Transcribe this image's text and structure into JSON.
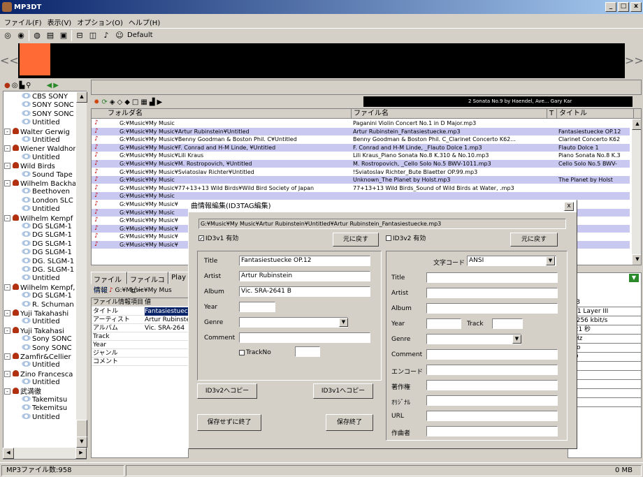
{
  "window": {
    "title": "MP3DT",
    "min": "_",
    "max": "□",
    "close": "x"
  },
  "menu": [
    "ファイル(F)",
    "表示(V)",
    "オプション(O)",
    "ヘルプ(H)"
  ],
  "toolbar": {
    "profile_label": "Default"
  },
  "player": {
    "prev": "<<",
    "next": ">>"
  },
  "tree": {
    "nodes": [
      {
        "label": "CBS SONY",
        "level": 2
      },
      {
        "label": "SONY SONC",
        "level": 2
      },
      {
        "label": "SONY SONC",
        "level": 2
      },
      {
        "label": "Untitled",
        "level": 2
      },
      {
        "label": "Walter Gerwig",
        "level": 1
      },
      {
        "label": "Untitled",
        "level": 2
      },
      {
        "label": "Wiener Waldhor",
        "level": 1
      },
      {
        "label": "Untitled",
        "level": 2
      },
      {
        "label": "Wild Birds",
        "level": 1
      },
      {
        "label": "Sound Tape",
        "level": 2
      },
      {
        "label": "Wilhelm Backha",
        "level": 1
      },
      {
        "label": "Beethoven",
        "level": 2
      },
      {
        "label": "London SLC",
        "level": 2
      },
      {
        "label": "Untitled",
        "level": 2
      },
      {
        "label": "Wilhelm Kempf",
        "level": 1
      },
      {
        "label": "DG SLGM-1",
        "level": 2
      },
      {
        "label": "DG SLGM-1",
        "level": 2
      },
      {
        "label": "DG SLGM-1",
        "level": 2
      },
      {
        "label": "DG SLGM-1",
        "level": 2
      },
      {
        "label": "DG. SLGM-1",
        "level": 2
      },
      {
        "label": "DG. SLGM-1",
        "level": 2
      },
      {
        "label": "Untitled",
        "level": 2
      },
      {
        "label": "Wilhelm Kempf,",
        "level": 1
      },
      {
        "label": "DG SLGM-1",
        "level": 2
      },
      {
        "label": "R. Schuman",
        "level": 2
      },
      {
        "label": "Yuji Takahashi",
        "level": 1
      },
      {
        "label": "Untitled",
        "level": 2
      },
      {
        "label": "Yuji Takahasi",
        "level": 1
      },
      {
        "label": "Sony SONC",
        "level": 2
      },
      {
        "label": "Sony SONC",
        "level": 2
      },
      {
        "label": "Zamfir&Cellier",
        "level": 1
      },
      {
        "label": "Untitled",
        "level": 2
      },
      {
        "label": "Zino Francesca",
        "level": 1
      },
      {
        "label": "Untitled",
        "level": 2
      },
      {
        "label": "武満徹",
        "level": 1
      },
      {
        "label": "Takemitsu",
        "level": 2
      },
      {
        "label": "Tekemitsu",
        "level": 2
      },
      {
        "label": "Untitled",
        "level": 2
      }
    ]
  },
  "nowplaying": "2   Sonata No.9 by Haendel, Ave...  Gary Kar",
  "filelist": {
    "headers": {
      "folder": "フォルダ名",
      "file": "ファイル名",
      "t": "T",
      "title": "タイトル"
    },
    "rows": [
      {
        "folder": "G:¥Music¥My Music",
        "file": "Paganini Violin Concert No.1 in D Major.mp3",
        "title": ""
      },
      {
        "folder": "G:¥Music¥My Music¥Artur Rubinstein¥Untitled",
        "file": "Artur Rubinstein_Fantasiestuecke.mp3",
        "title": "Fantasiestuecke OP.12"
      },
      {
        "folder": "G:¥Music¥My Music¥Benny Goodman & Boston Phil. C¥Untitled",
        "file": "Benny Goodman & Boston Phil. C_Clarinet Concerto K62...",
        "title": "Clarinet Concerto K62"
      },
      {
        "folder": "G:¥Music¥My Music¥F. Conrad and H-M Linde, ¥Untitled",
        "file": "F. Conrad and H-M Linde, _Flauto Dolce 1.mp3",
        "title": "Flauto Dolce 1"
      },
      {
        "folder": "G:¥Music¥My Music¥Lili Kraus",
        "file": "Lili Kraus_Piano Sonata No.8 K.310 & No.10.mp3",
        "title": "Piano Sonata No.8 K.3"
      },
      {
        "folder": "G:¥Music¥My Music¥M. Rostropovich, ¥Untitled",
        "file": "M. Rostropovich, _Cello Solo No.5 BWV-1011.mp3",
        "title": "Cello Solo No.5 BWV-"
      },
      {
        "folder": "G:¥Music¥My Music¥Sviatoslav Richter¥Untitled",
        "file": "!Sviatoslav Richter_Bute Blaetter OP.99.mp3",
        "title": ""
      },
      {
        "folder": "G:¥Music¥My Music",
        "file": "Unknown_The Planet by Holst.mp3",
        "title": "The Planet by Holst"
      },
      {
        "folder": "G:¥Music¥My Music¥77+13+13 Wild Birds¥Wild Bird Society of Japan",
        "file": "77+13+13 Wild Birds_Sound of Wild Birds at Water, .mp3",
        "title": ""
      },
      {
        "folder": "G:¥Music¥My Music",
        "file": "",
        "title": ""
      },
      {
        "folder": "G:¥Music¥My Music¥",
        "file": "",
        "title": ""
      },
      {
        "folder": "G:¥Music¥My Music",
        "file": "",
        "title": ""
      },
      {
        "folder": "G:¥Music¥My Music¥",
        "file": "",
        "title": ""
      },
      {
        "folder": "G:¥Music¥My Music¥",
        "file": "",
        "title": ""
      },
      {
        "folder": "G:¥Music¥My Music¥",
        "file": "",
        "title": ""
      },
      {
        "folder": "G:¥Music¥My Music¥",
        "file": "",
        "title": ""
      }
    ]
  },
  "lower": {
    "tabs": [
      "ファイル情報",
      "ファイルコピー",
      "Play"
    ],
    "path": "G:¥Music¥My Mus",
    "info_headers": {
      "item": "ファイル情報項目",
      "value": "値"
    },
    "info_rows": [
      {
        "item": "タイトル",
        "value": "Fantasiestuec"
      },
      {
        "item": "アーティスト",
        "value": "Artur Rubinste"
      },
      {
        "item": "アルバム",
        "value": "Vic. SRA-264"
      },
      {
        "item": "Track",
        "value": ""
      },
      {
        "item": "Year",
        "value": ""
      },
      {
        "item": "ジャンル",
        "value": ""
      },
      {
        "item": "コメント",
        "value": ""
      }
    ],
    "right_values": [
      "MB",
      "G 1 Layer III",
      "2 256 kbit/s",
      "021 秒",
      "KHz",
      "reo",
      "19",
      "",
      "e",
      "",
      "",
      ""
    ]
  },
  "status": {
    "count": "MP3ファイル数:958",
    "size": "0 MB"
  },
  "dialog": {
    "title": "曲情報編集(ID3TAG編集)",
    "close": "x",
    "path": "G:¥Music¥My Music¥Artur Rubinstein¥Untitled¥Artur Rubinstein_Fantasiestuecke.mp3",
    "v1_label": "ID3v1 有効",
    "v1_checked": "✓",
    "v2_label": "ID3v2 有効",
    "revert": "元に戻す",
    "v1": {
      "title_label": "Title",
      "title": "Fantasiestuecke OP.12",
      "artist_label": "Artist",
      "artist": "Artur Rubinstein",
      "album_label": "Album",
      "album": "Vic. SRA-2641  B",
      "year_label": "Year",
      "year": "",
      "genre_label": "Genre",
      "genre": "",
      "comment_label": "Comment",
      "comment": "",
      "trackno_label": "TrackNo",
      "trackno": ""
    },
    "v2": {
      "encoding_label": "文字コード",
      "encoding": "ANSI",
      "title_label": "Title",
      "artist_label": "Artist",
      "album_label": "Album",
      "year_label": "Year",
      "track_label": "Track",
      "genre_label": "Genre",
      "comment_label": "Comment",
      "encoder_label": "エンコード",
      "copyright_label": "著作権",
      "original_label": "ｵﾘｼﾞﾅﾙ",
      "url_label": "URL",
      "composer_label": "作曲者"
    },
    "copy_to_v2": "ID3v2へコピー",
    "copy_to_v1": "ID3v1へコピー",
    "exit_nosave": "保存せずに終了",
    "exit_save": "保存終了"
  }
}
